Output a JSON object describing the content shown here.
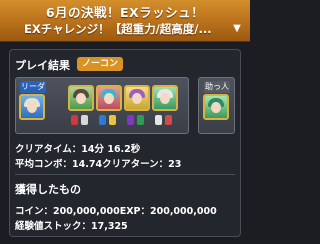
{
  "header": {
    "title_line1": "6月の決戦！EXラッシュ！",
    "title_line2": "EXチャレンジ！【超重力/超高度/...",
    "dropdown_icon": "chevron-down-icon"
  },
  "play_result": {
    "heading": "プレイ結果",
    "badge": "ノーコン",
    "leader_label": "リーダー",
    "friend_label": "助っ人",
    "clear_time": "クリアタイム：14分 16.2秒",
    "avg_combo": "平均コンボ：14.74",
    "clear_turns": "クリアターン：23"
  },
  "rewards": {
    "heading": "獲得したもの",
    "coin_exp": "コイン：200,000,000EXP：200,000,000",
    "exp_stock": "経験値ストック：17,325"
  },
  "colors": {
    "header": "#c07a1f",
    "badge": "#d99325",
    "leader": "#2b62b8",
    "panel": "#23262d"
  }
}
